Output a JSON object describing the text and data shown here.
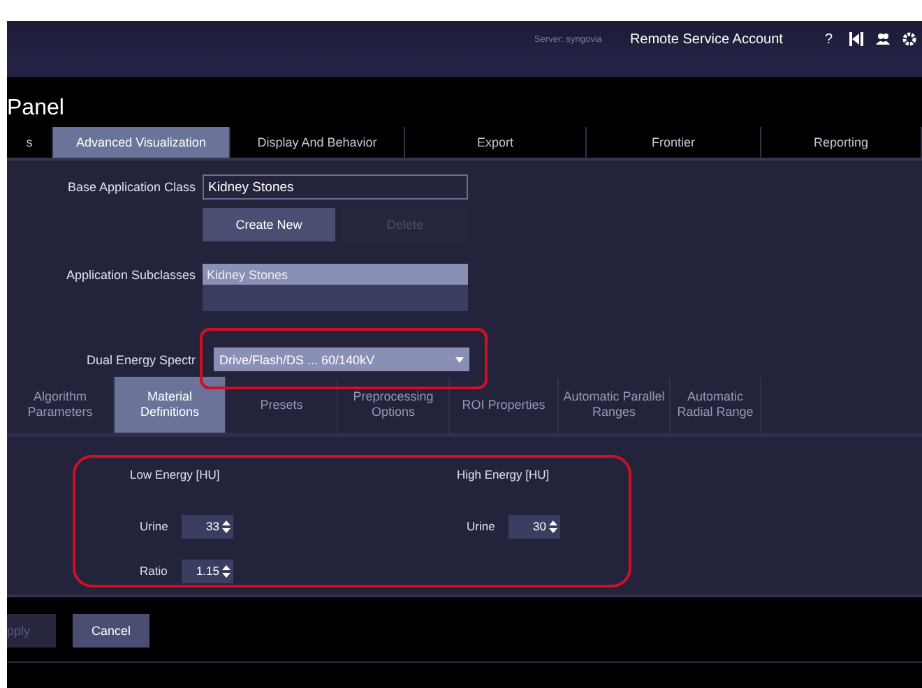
{
  "header": {
    "server": "Server: syngovia",
    "account": "Remote Service Account",
    "help": "?"
  },
  "panel_title": "Panel",
  "tabs": [
    {
      "label": "s",
      "selected": false
    },
    {
      "label": "Advanced Visualization",
      "selected": true
    },
    {
      "label": "Display And Behavior",
      "selected": false
    },
    {
      "label": "Export",
      "selected": false
    },
    {
      "label": "Frontier",
      "selected": false
    },
    {
      "label": "Reporting",
      "selected": false
    }
  ],
  "form": {
    "base_class": {
      "label": "Base Application Class",
      "value": "Kidney Stones"
    },
    "buttons": [
      {
        "label": "Create New",
        "disabled": false
      },
      {
        "label": "Delete",
        "disabled": true
      }
    ],
    "subclasses": {
      "label": "Application Subclasses",
      "items": [
        {
          "label": "Kidney Stones",
          "selected": true
        }
      ]
    },
    "spectra": {
      "label": "Dual Energy Spectr",
      "value": "Drive/Flash/DS ... 60/140kV",
      "highlighted": true
    }
  },
  "sub_tabs": [
    {
      "label": "Algorithm Parameters",
      "selected": false
    },
    {
      "label": "Material Definitions",
      "selected": true
    },
    {
      "label": "Presets",
      "selected": false
    },
    {
      "label": "Preprocessing Options",
      "selected": false
    },
    {
      "label": "ROI Properties",
      "selected": false
    },
    {
      "label": "Automatic Parallel Ranges",
      "selected": false
    },
    {
      "label": "Automatic Radial Range",
      "selected": false
    }
  ],
  "materials": {
    "highlighted": true,
    "columns": [
      {
        "title": "Low Energy [HU]",
        "rows": [
          {
            "label": "Urine",
            "value": "33"
          },
          {
            "label": "Ratio",
            "value": "1.15"
          }
        ]
      },
      {
        "title": "High Energy [HU]",
        "rows": [
          {
            "label": "Urine",
            "value": "30"
          }
        ]
      }
    ]
  },
  "footer": [
    {
      "label": "pply",
      "disabled": true
    },
    {
      "label": "Cancel",
      "disabled": false
    }
  ]
}
